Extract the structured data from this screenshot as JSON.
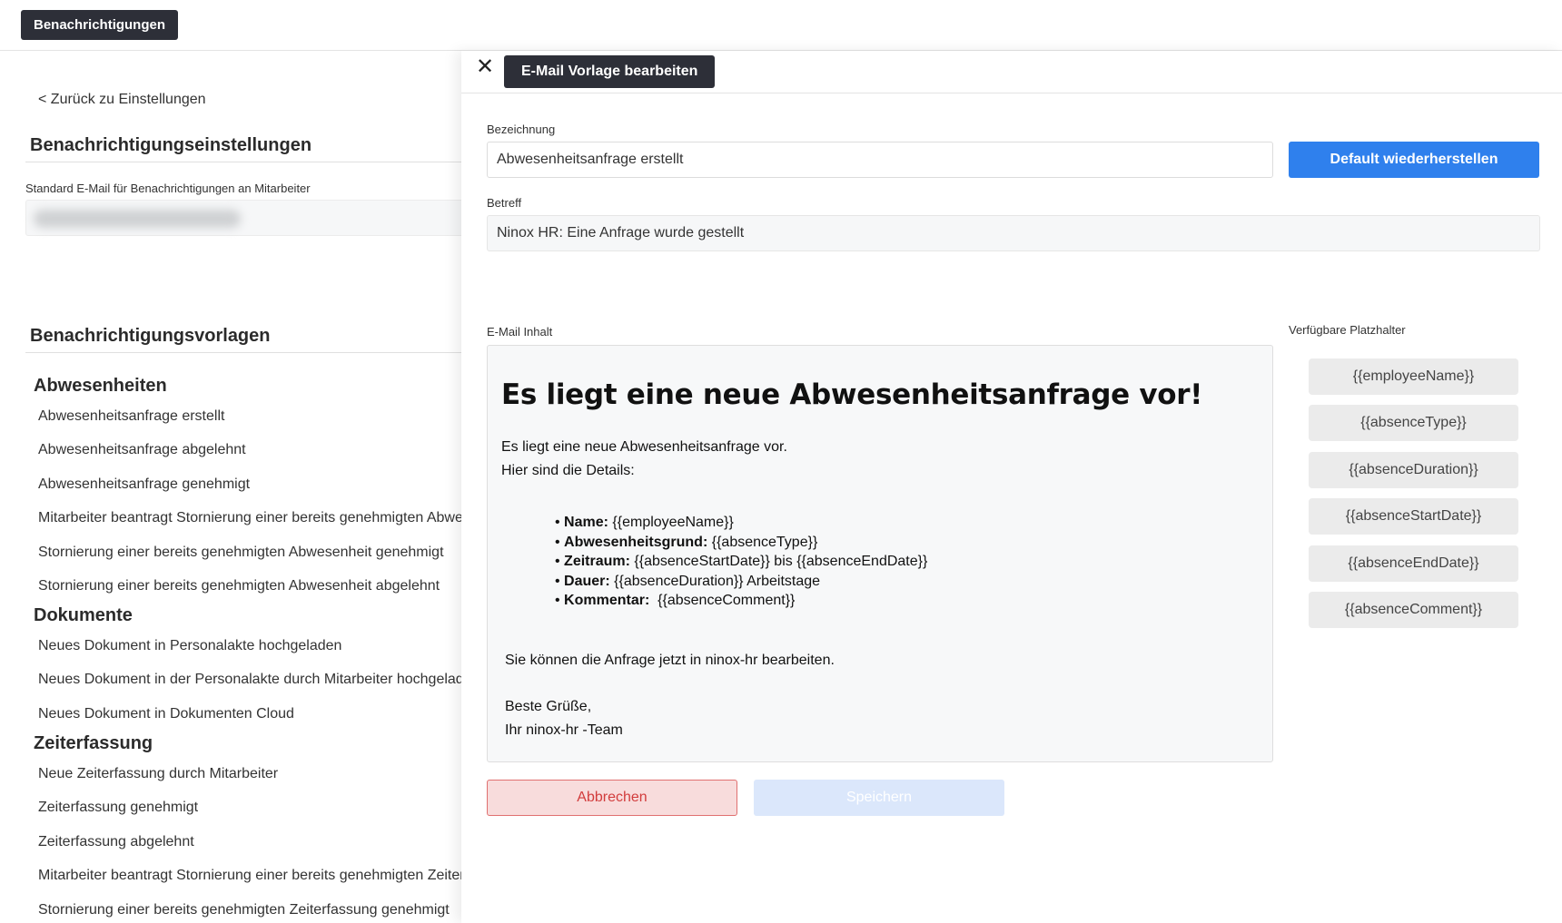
{
  "topbar": {
    "tab_label": "Benachrichtigungen"
  },
  "left": {
    "back_link": "< Zurück zu Einstellungen",
    "settings_title": "Benachrichtigungseinstellungen",
    "default_email_label": "Standard E-Mail für Benachrichtigungen an Mitarbeiter",
    "templates_title": "Benachrichtigungsvorlagen",
    "groups": [
      {
        "title": "Abwesenheiten",
        "items": [
          "Abwesenheitsanfrage erstellt",
          "Abwesenheitsanfrage abgelehnt",
          "Abwesenheitsanfrage genehmigt",
          "Mitarbeiter beantragt Stornierung einer bereits genehmigten Abwesenheit",
          "Stornierung einer bereits genehmigten Abwesenheit genehmigt",
          "Stornierung einer bereits genehmigten Abwesenheit abgelehnt"
        ]
      },
      {
        "title": "Dokumente",
        "items": [
          "Neues Dokument in Personalakte hochgeladen",
          "Neues Dokument in der Personalakte durch Mitarbeiter hochgeladen",
          "Neues Dokument in Dokumenten Cloud"
        ]
      },
      {
        "title": "Zeiterfassung",
        "items": [
          "Neue Zeiterfassung durch Mitarbeiter",
          "Zeiterfassung genehmigt",
          "Zeiterfassung abgelehnt",
          "Mitarbeiter beantragt Stornierung einer bereits genehmigten Zeiterfassung",
          "Stornierung einer bereits genehmigten Zeiterfassung genehmigt"
        ]
      }
    ]
  },
  "panel": {
    "close_icon": "close-icon",
    "tab_label": "E-Mail Vorlage bearbeiten",
    "name_label": "Bezeichnung",
    "name_value": "Abwesenheitsanfrage erstellt",
    "restore_button": "Default wiederherstellen",
    "subject_label": "Betreff",
    "subject_value": "Ninox HR: Eine Anfrage wurde gestellt",
    "content_label": "E-Mail Inhalt",
    "content": {
      "heading": "Es liegt eine neue Abwesenheitsanfrage vor!",
      "intro_1": "Es liegt eine neue Abwesenheitsanfrage vor.",
      "intro_2": "Hier sind die Details:",
      "bullets": [
        {
          "label": "Name:",
          "value": " {{employeeName}}"
        },
        {
          "label": "Abwesenheitsgrund:",
          "value": " {{absenceType}}"
        },
        {
          "label": "Zeitraum:",
          "value": " {{absenceStartDate}} bis {{absenceEndDate}}"
        },
        {
          "label": "Dauer:",
          "value": " {{absenceDuration}} Arbeitstage"
        },
        {
          "label": "Kommentar:",
          "value": "  {{absenceComment}}"
        }
      ],
      "outro": "Sie können die Anfrage jetzt in ninox-hr bearbeiten.",
      "greeting_1": "Beste Grüße,",
      "greeting_2": "Ihr ninox-hr -Team"
    },
    "placeholders_title": "Verfügbare Platzhalter",
    "placeholders": [
      "{{employeeName}}",
      "{{absenceType}}",
      "{{absenceDuration}}",
      "{{absenceStartDate}}",
      "{{absenceEndDate}}",
      "{{absenceComment}}"
    ],
    "cancel_button": "Abbrechen",
    "save_button": "Speichern"
  },
  "colors": {
    "dark_tab": "#2d2f38",
    "primary": "#2f80ed",
    "cancel_bg": "#f8dcdc",
    "cancel_text": "#d23c3c",
    "save_disabled": "#dbe7fb"
  }
}
